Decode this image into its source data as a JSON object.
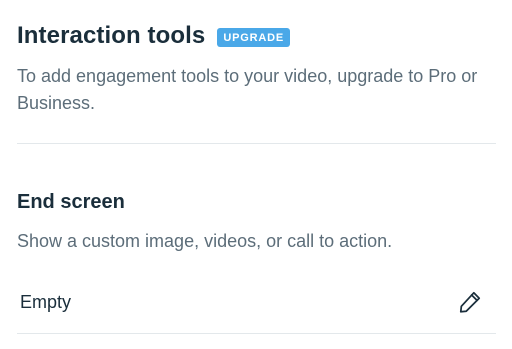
{
  "interaction_tools": {
    "title": "Interaction tools",
    "badge": "UPGRADE",
    "description": "To add engagement tools to your video, upgrade to Pro or Business."
  },
  "end_screen": {
    "title": "End screen",
    "description": "Show a custom image, videos, or call to action.",
    "value": "Empty",
    "edit_icon": "pencil-icon"
  },
  "colors": {
    "badge_bg": "#4aa8e8",
    "title": "#1a2e3b",
    "description": "#5c6d79",
    "divider": "#e3e8eb"
  }
}
